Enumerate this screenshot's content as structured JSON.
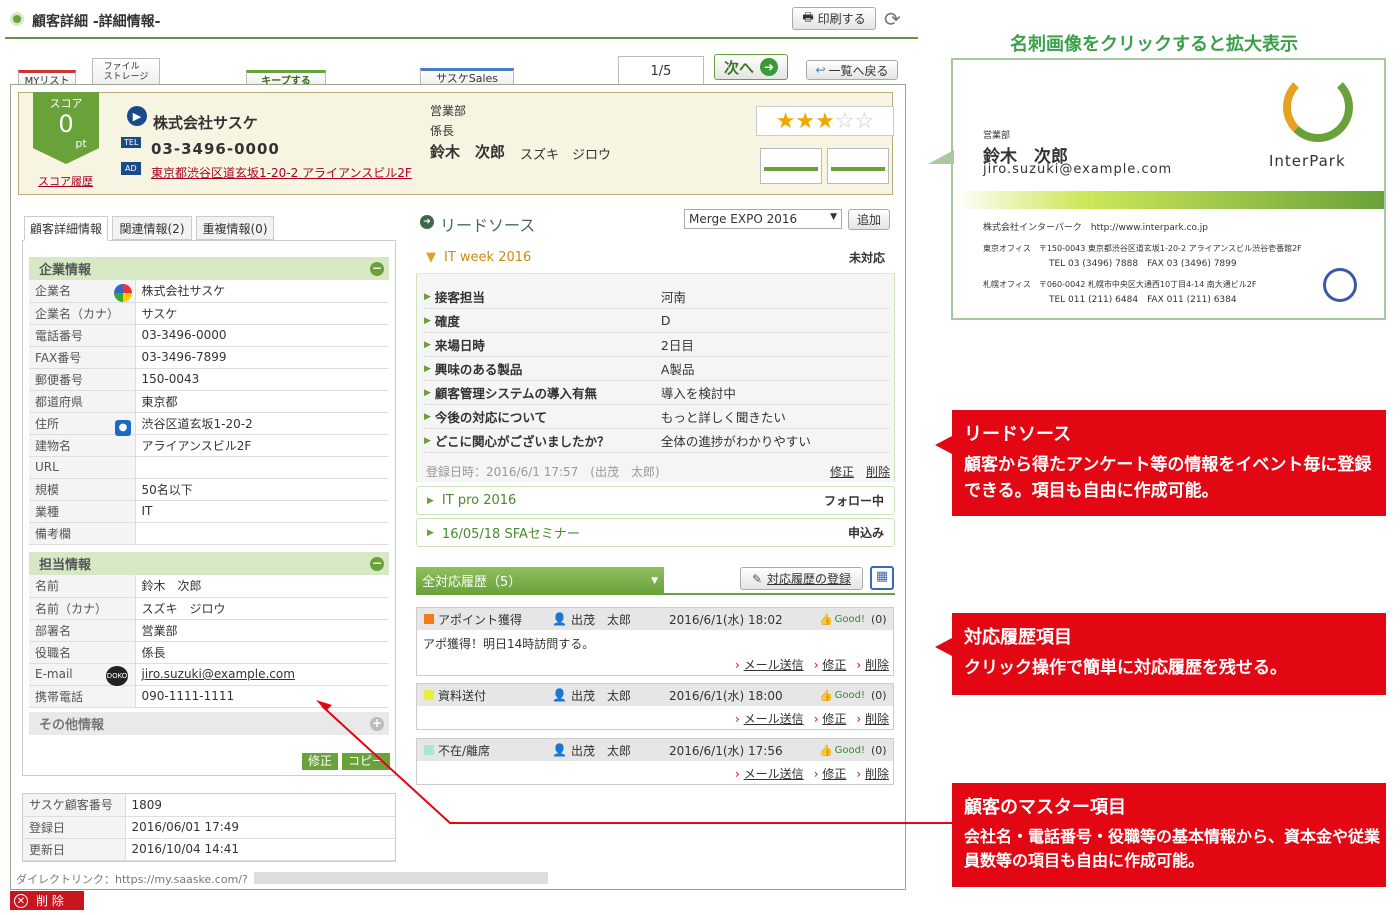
{
  "header": {
    "title": "顧客詳細 -詳細情報-",
    "print_label": "印刷する"
  },
  "tabs": {
    "mylist": "MYリスト",
    "filestorage": "ファイル\nストレージ",
    "keep": "キープする",
    "saaske_sales": "サスケSales",
    "page": "1/5",
    "next": "次へ",
    "back_to_list": "一覧へ戻る"
  },
  "card": {
    "score_label": "スコア",
    "score_value": "0",
    "score_unit": "pt",
    "score_history": "スコア履歴",
    "company": "株式会社サスケ",
    "tel_tag": "TEL",
    "tel": "03-3496-0000",
    "ad_tag": "AD",
    "address": "東京都渋谷区道玄坂1-20-2 アライアンスビル2F",
    "dept": "営業部",
    "title": "係長",
    "name": "鈴木　次郎",
    "kana": "スズキ　ジロウ",
    "rating": 3,
    "rating_max": 5
  },
  "detail_tabs": [
    "顧客詳細情報",
    "関連情報(2)",
    "重複情報(0)"
  ],
  "company_section": {
    "heading": "企業情報",
    "rows": [
      {
        "k": "企業名",
        "v": "株式会社サスケ"
      },
      {
        "k": "企業名（カナ）",
        "v": "サスケ"
      },
      {
        "k": "電話番号",
        "v": "03-3496-0000"
      },
      {
        "k": "FAX番号",
        "v": "03-3496-7899"
      },
      {
        "k": "郵便番号",
        "v": "150-0043"
      },
      {
        "k": "都道府県",
        "v": "東京都"
      },
      {
        "k": "住所",
        "v": "渋谷区道玄坂1-20-2"
      },
      {
        "k": "建物名",
        "v": "アライアンスビル2F"
      },
      {
        "k": "URL",
        "v": ""
      },
      {
        "k": "規模",
        "v": "50名以下"
      },
      {
        "k": "業種",
        "v": "IT"
      },
      {
        "k": "備考欄",
        "v": ""
      }
    ]
  },
  "contact_section": {
    "heading": "担当情報",
    "rows": [
      {
        "k": "名前",
        "v": "鈴木　次郎"
      },
      {
        "k": "名前（カナ）",
        "v": "スズキ　ジロウ"
      },
      {
        "k": "部署名",
        "v": "営業部"
      },
      {
        "k": "役職名",
        "v": "係長"
      },
      {
        "k": "E-mail",
        "v": "jiro.suzuki@example.com"
      },
      {
        "k": "携帯電話",
        "v": "090-1111-1111"
      }
    ]
  },
  "other_section": {
    "heading": "その他情報"
  },
  "actions": {
    "edit": "修正",
    "copy": "コピー",
    "delete": "削 除"
  },
  "meta": [
    {
      "k": "サスケ顧客番号",
      "v": "1809"
    },
    {
      "k": "登録日",
      "v": "2016/06/01 17:49"
    },
    {
      "k": "更新日",
      "v": "2016/10/04 14:41"
    }
  ],
  "direct_link": "ダイレクトリンク：https://my.saaske.com/?",
  "lead": {
    "heading": "リードソース",
    "select": "Merge EXPO 2016",
    "add": "追加",
    "events": [
      {
        "name": "IT week 2016",
        "status": "未対応"
      },
      {
        "name": "IT pro 2016",
        "status": "フォロー中"
      },
      {
        "name": "16/05/18 SFAセミナー",
        "status": "申込み"
      }
    ],
    "rows": [
      {
        "k": "接客担当",
        "v": "河南"
      },
      {
        "k": "確度",
        "v": "D"
      },
      {
        "k": "来場日時",
        "v": "2日目"
      },
      {
        "k": "興味のある製品",
        "v": "A製品"
      },
      {
        "k": "顧客管理システムの導入有無",
        "v": "導入を検討中"
      },
      {
        "k": "今後の対応について",
        "v": "もっと詳しく聞きたい"
      },
      {
        "k": "どこに関心がございましたか？",
        "v": "全体の進捗がわかりやすい"
      }
    ],
    "registered": "登録日時：2016/6/1 17:57　(出茂　太郎)",
    "edit": "修正",
    "delete": "削除"
  },
  "history": {
    "heading": "全対応履歴（5）",
    "register": "対応履歴の登録",
    "mail": "メール送信",
    "edit": "修正",
    "delete": "削除",
    "good": "Good!",
    "items": [
      {
        "type": "アポイント獲得",
        "color": "#f07d14",
        "user": "出茂　太郎",
        "date": "2016/6/1(水) 18:02",
        "count": "(0)",
        "body": "アポ獲得！明日14時訪問する。"
      },
      {
        "type": "資料送付",
        "color": "#e6f03c",
        "user": "出茂　太郎",
        "date": "2016/6/1(水) 18:00",
        "count": "(0)",
        "body": ""
      },
      {
        "type": "不在/離席",
        "color": "#a8e6dc",
        "user": "出茂　太郎",
        "date": "2016/6/1(水) 17:56",
        "count": "(0)",
        "body": ""
      }
    ]
  },
  "bizcard": {
    "caption": "名刺画像をクリックすると拡大表示",
    "dept": "営業部",
    "name": "鈴木　次郎",
    "email": "jiro.suzuki@example.com",
    "brand": "InterPark",
    "company_line": "株式会社インターパーク　http://www.interpark.co.jp",
    "tokyo": "東京オフィス　〒150-0043 東京都渋谷区道玄坂1-20-2 アライアンスビル渋谷壱番館2F",
    "tokyo_tel": "TEL 03 (3496) 7888　FAX 03 (3496) 7899",
    "sapporo": "札幌オフィス　〒060-0042 札幌市中央区大通西10丁目4-14 南大通ビル2F",
    "sapporo_tel": "TEL 011 (211) 6484　FAX 011 (211) 6384"
  },
  "callouts": [
    {
      "title": "リードソース",
      "desc": "顧客から得たアンケート等の情報をイベント毎に登録できる。項目も自由に作成可能。"
    },
    {
      "title": "対応履歴項目",
      "desc": "クリック操作で簡単に対応履歴を残せる。"
    },
    {
      "title": "顧客のマスター項目",
      "desc": "会社名・電話番号・役職等の基本情報から、資本金や従業員数等の項目も自由に作成可能。"
    }
  ],
  "colors": {
    "green": "#6aa23a",
    "red": "#e30613",
    "card_bg": "#f7f4e2"
  }
}
